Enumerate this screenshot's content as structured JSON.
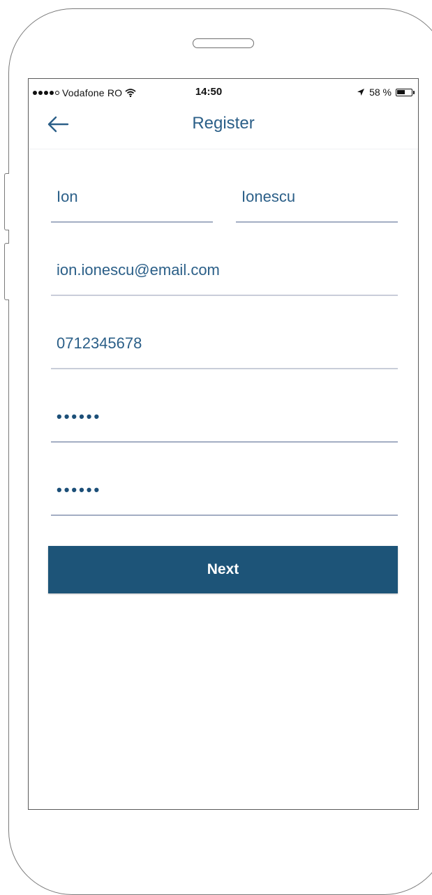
{
  "status_bar": {
    "carrier": "Vodafone RO",
    "time": "14:50",
    "battery_text": "58 %",
    "battery_level": 0.58,
    "icons": [
      "signal-dots-icon",
      "wifi-icon",
      "location-arrow-icon",
      "battery-icon"
    ]
  },
  "nav": {
    "title": "Register",
    "back_icon": "arrow-left-icon"
  },
  "form": {
    "first_name": "Ion",
    "last_name": "Ionescu",
    "email": "ion.ionescu@email.com",
    "phone": "0712345678",
    "password": "123456",
    "confirm_password": "123456"
  },
  "buttons": {
    "next_label": "Next"
  },
  "colors": {
    "accent": "#2b5f88",
    "button": "#1d5478",
    "underline": "#c9cdd9"
  }
}
